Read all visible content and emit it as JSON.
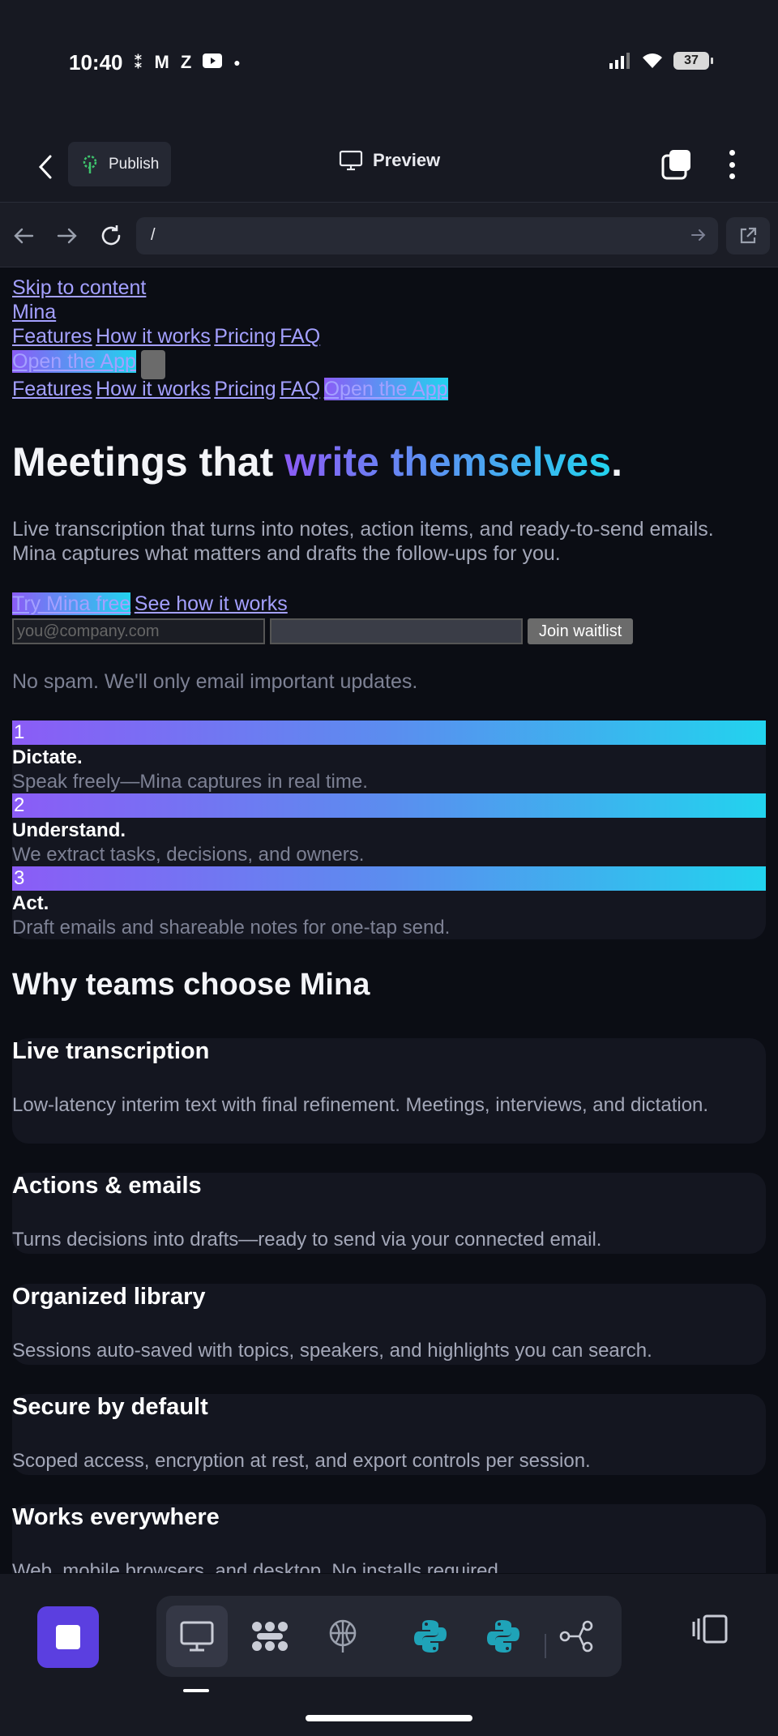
{
  "status_bar": {
    "time": "10:40",
    "battery": "37"
  },
  "app_bar": {
    "publish_label": "Publish",
    "preview_label": "Preview"
  },
  "url_bar": {
    "url": "/"
  },
  "page": {
    "skip_link": "Skip to content",
    "brand": "Mina",
    "nav": [
      "Features",
      "How it works",
      "Pricing",
      "FAQ"
    ],
    "open_app": "Open the App",
    "hero": {
      "title_plain": "Meetings that ",
      "title_grad": "write themselves",
      "title_end": ".",
      "lead": "Live transcription that turns into notes, action items, and ready-to-send emails. Mina captures what matters and drafts the follow-ups for you.",
      "cta_primary": "Try Mina free",
      "cta_secondary": "See how it works",
      "email_placeholder": "you@company.com",
      "join_label": "Join waitlist",
      "note": "No spam. We'll only email important updates."
    },
    "steps": [
      {
        "num": "1",
        "title": "Dictate.",
        "desc": "Speak freely—Mina captures in real time."
      },
      {
        "num": "2",
        "title": "Understand.",
        "desc": "We extract tasks, decisions, and owners."
      },
      {
        "num": "3",
        "title": "Act.",
        "desc": "Draft emails and shareable notes for one-tap send."
      }
    ],
    "why_title": "Why teams choose Mina",
    "features": [
      {
        "title": "Live transcription",
        "desc": "Low-latency interim text with final refinement. Meetings, interviews, and dictation."
      },
      {
        "title": "Actions & emails",
        "desc": "Turns decisions into drafts—ready to send via your connected email."
      },
      {
        "title": "Organized library",
        "desc": "Sessions auto-saved with topics, speakers, and highlights you can search."
      },
      {
        "title": "Secure by default",
        "desc": "Scoped access, encryption at rest, and export controls per session."
      },
      {
        "title": "Works everywhere",
        "desc": "Web, mobile browsers, and desktop. No installs required."
      }
    ]
  },
  "colors": {
    "accent_start": "#8b5cf6",
    "accent_end": "#22d3ee",
    "stop_button": "#5b3fe0",
    "python_icon": "#1fa3b8"
  }
}
